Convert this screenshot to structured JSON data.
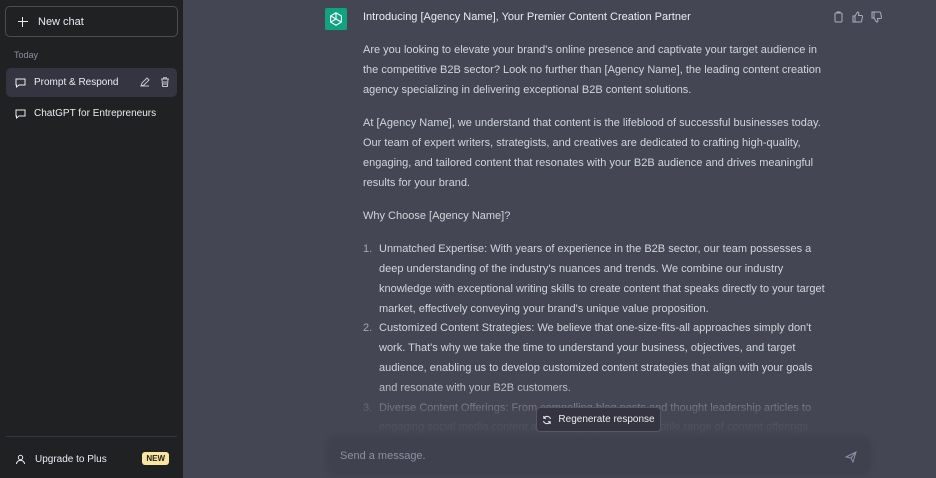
{
  "sidebar": {
    "new_chat_label": "New chat",
    "section_label": "Today",
    "items": [
      {
        "label": "Prompt & Respond",
        "active": true
      },
      {
        "label": "ChatGPT for Entrepreneurs",
        "active": false
      }
    ],
    "upgrade_label": "Upgrade to Plus",
    "upgrade_badge": "NEW"
  },
  "message": {
    "title": "Introducing [Agency Name], Your Premier Content Creation Partner",
    "paragraphs": [
      "Are you looking to elevate your brand's online presence and captivate your target audience in the competitive B2B sector? Look no further than [Agency Name], the leading content creation agency specializing in delivering exceptional B2B content solutions.",
      "At [Agency Name], we understand that content is the lifeblood of successful businesses today. Our team of expert writers, strategists, and creatives are dedicated to crafting high-quality, engaging, and tailored content that resonates with your B2B audience and drives meaningful results for your brand.",
      "Why Choose [Agency Name]?"
    ],
    "list": [
      {
        "num": "1.",
        "text": "Unmatched Expertise: With years of experience in the B2B sector, our team possesses a deep understanding of the industry's nuances and trends. We combine our industry knowledge with exceptional writing skills to create content that speaks directly to your target market, effectively conveying your brand's unique value proposition."
      },
      {
        "num": "2.",
        "text": "Customized Content Strategies: We believe that one-size-fits-all approaches simply don't work. That's why we take the time to understand your business, objectives, and target audience, enabling us to develop customized content strategies that align with your goals and resonate with your B2B customers."
      },
      {
        "num": "3.",
        "text": "Diverse Content Offerings: From compelling blog posts and thought leadership articles to engaging social media content and white papers, our versatile range of content offerings"
      }
    ]
  },
  "regenerate_label": "Regenerate response",
  "composer": {
    "placeholder": "Send a message."
  },
  "colors": {
    "sidebar_bg": "#202123",
    "main_bg": "#444654",
    "avatar_bg": "#10a37f",
    "badge_bg": "#fae69e"
  }
}
